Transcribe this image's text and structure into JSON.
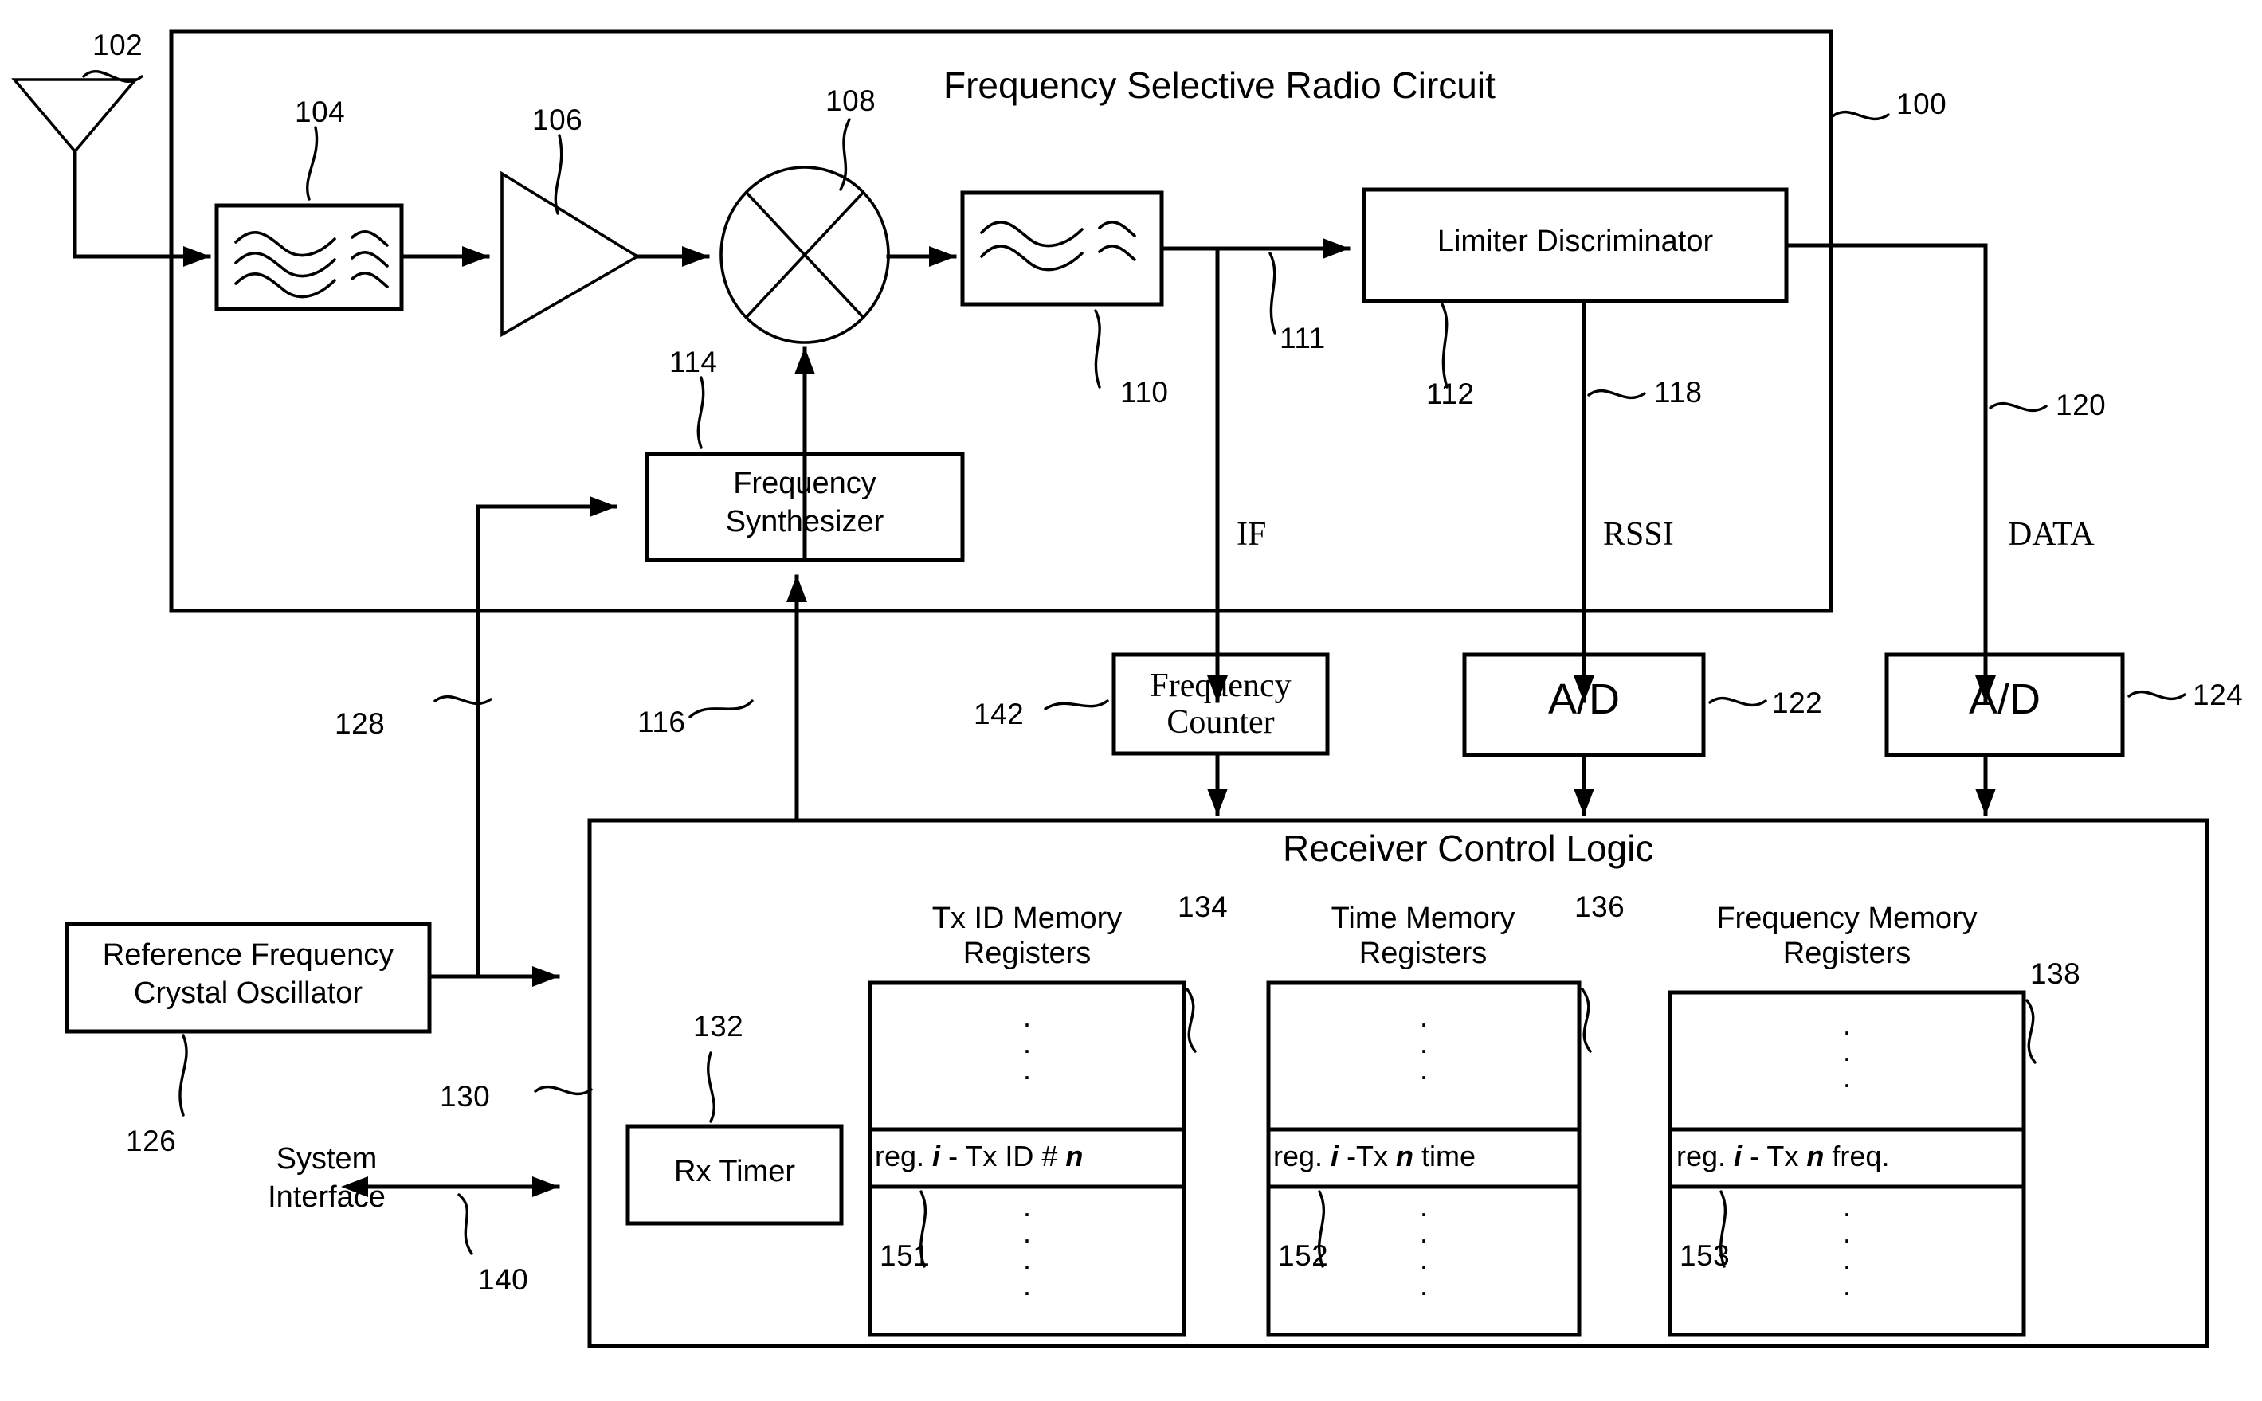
{
  "figure": {
    "title_top": "Frequency Selective Radio Circuit",
    "title_bottom": "Receiver Control Logic"
  },
  "blocks": {
    "bandpass_filter_1": {
      "ref": "104",
      "icon": "wave-filter-icon"
    },
    "amplifier": {
      "ref": "106",
      "icon": "amplifier-triangle-icon"
    },
    "mixer": {
      "ref": "108",
      "icon": "mixer-x-icon"
    },
    "bandpass_filter_2": {
      "ref": "110",
      "icon": "wave-filter-icon"
    },
    "limiter_discriminator": {
      "ref": "112",
      "label": "Limiter Discriminator"
    },
    "frequency_synthesizer": {
      "ref": "114",
      "label_line1": "Frequency",
      "label_line2": "Synthesizer"
    },
    "frequency_counter": {
      "ref": "142",
      "label_line1": "Frequency",
      "label_line2": "Counter"
    },
    "ad_rssi": {
      "ref": "122",
      "label": "A/D"
    },
    "ad_data": {
      "ref": "124",
      "label": "A/D"
    },
    "reference_oscillator": {
      "ref": "126",
      "label_line1": "Reference Frequency",
      "label_line2": "Crystal Oscillator"
    },
    "rx_timer": {
      "ref": "132",
      "label": "Rx Timer"
    },
    "antenna": {
      "ref": "102",
      "icon": "antenna-icon"
    }
  },
  "signal_labels": {
    "if": "IF",
    "rssi": "RSSI",
    "data": "DATA",
    "system_interface_line1": "System",
    "system_interface_line2": "Interface"
  },
  "ref_numbers": {
    "antenna": "102",
    "radio_circuit": "100",
    "filter1": "104",
    "amplifier": "106",
    "mixer": "108",
    "filter2": "110",
    "if_tap": "111",
    "limiter": "112",
    "synthesizer": "114",
    "synth_control": "116",
    "rssi_line": "118",
    "data_line": "120",
    "ad_rssi": "122",
    "ad_data": "124",
    "ref_osc": "126",
    "ref_osc_to_synth": "128",
    "control_logic": "130",
    "rx_timer": "132",
    "txid_registers": "134",
    "time_registers": "136",
    "freq_registers": "138",
    "system_interface": "140",
    "freq_counter": "142",
    "txid_reg_i": "151",
    "time_reg_i": "152",
    "freq_reg_i": "153"
  },
  "register_groups": [
    {
      "name": "tx-id-memory-registers",
      "caption_line1": "Tx ID Memory",
      "caption_line2": "Registers",
      "group_ref": "134",
      "row_ref": "151",
      "row_prefix": "reg. ",
      "row_var1": "i",
      "row_mid": " - Tx ID # ",
      "row_var2": "n",
      "row_suffix": ""
    },
    {
      "name": "time-memory-registers",
      "caption_line1": "Time Memory",
      "caption_line2": "Registers",
      "group_ref": "136",
      "row_ref": "152",
      "row_prefix": "reg. ",
      "row_var1": "i",
      "row_mid": " -Tx ",
      "row_var2": "n",
      "row_suffix": " time"
    },
    {
      "name": "frequency-memory-registers",
      "caption_line1": "Frequency Memory",
      "caption_line2": "Registers",
      "group_ref": "138",
      "row_ref": "153",
      "row_prefix": "reg. ",
      "row_var1": "i",
      "row_mid": " - Tx ",
      "row_var2": "n",
      "row_suffix": " freq."
    }
  ],
  "colors": {
    "ink": "#000000",
    "paper": "#ffffff"
  },
  "dots": "·\n·\n·"
}
